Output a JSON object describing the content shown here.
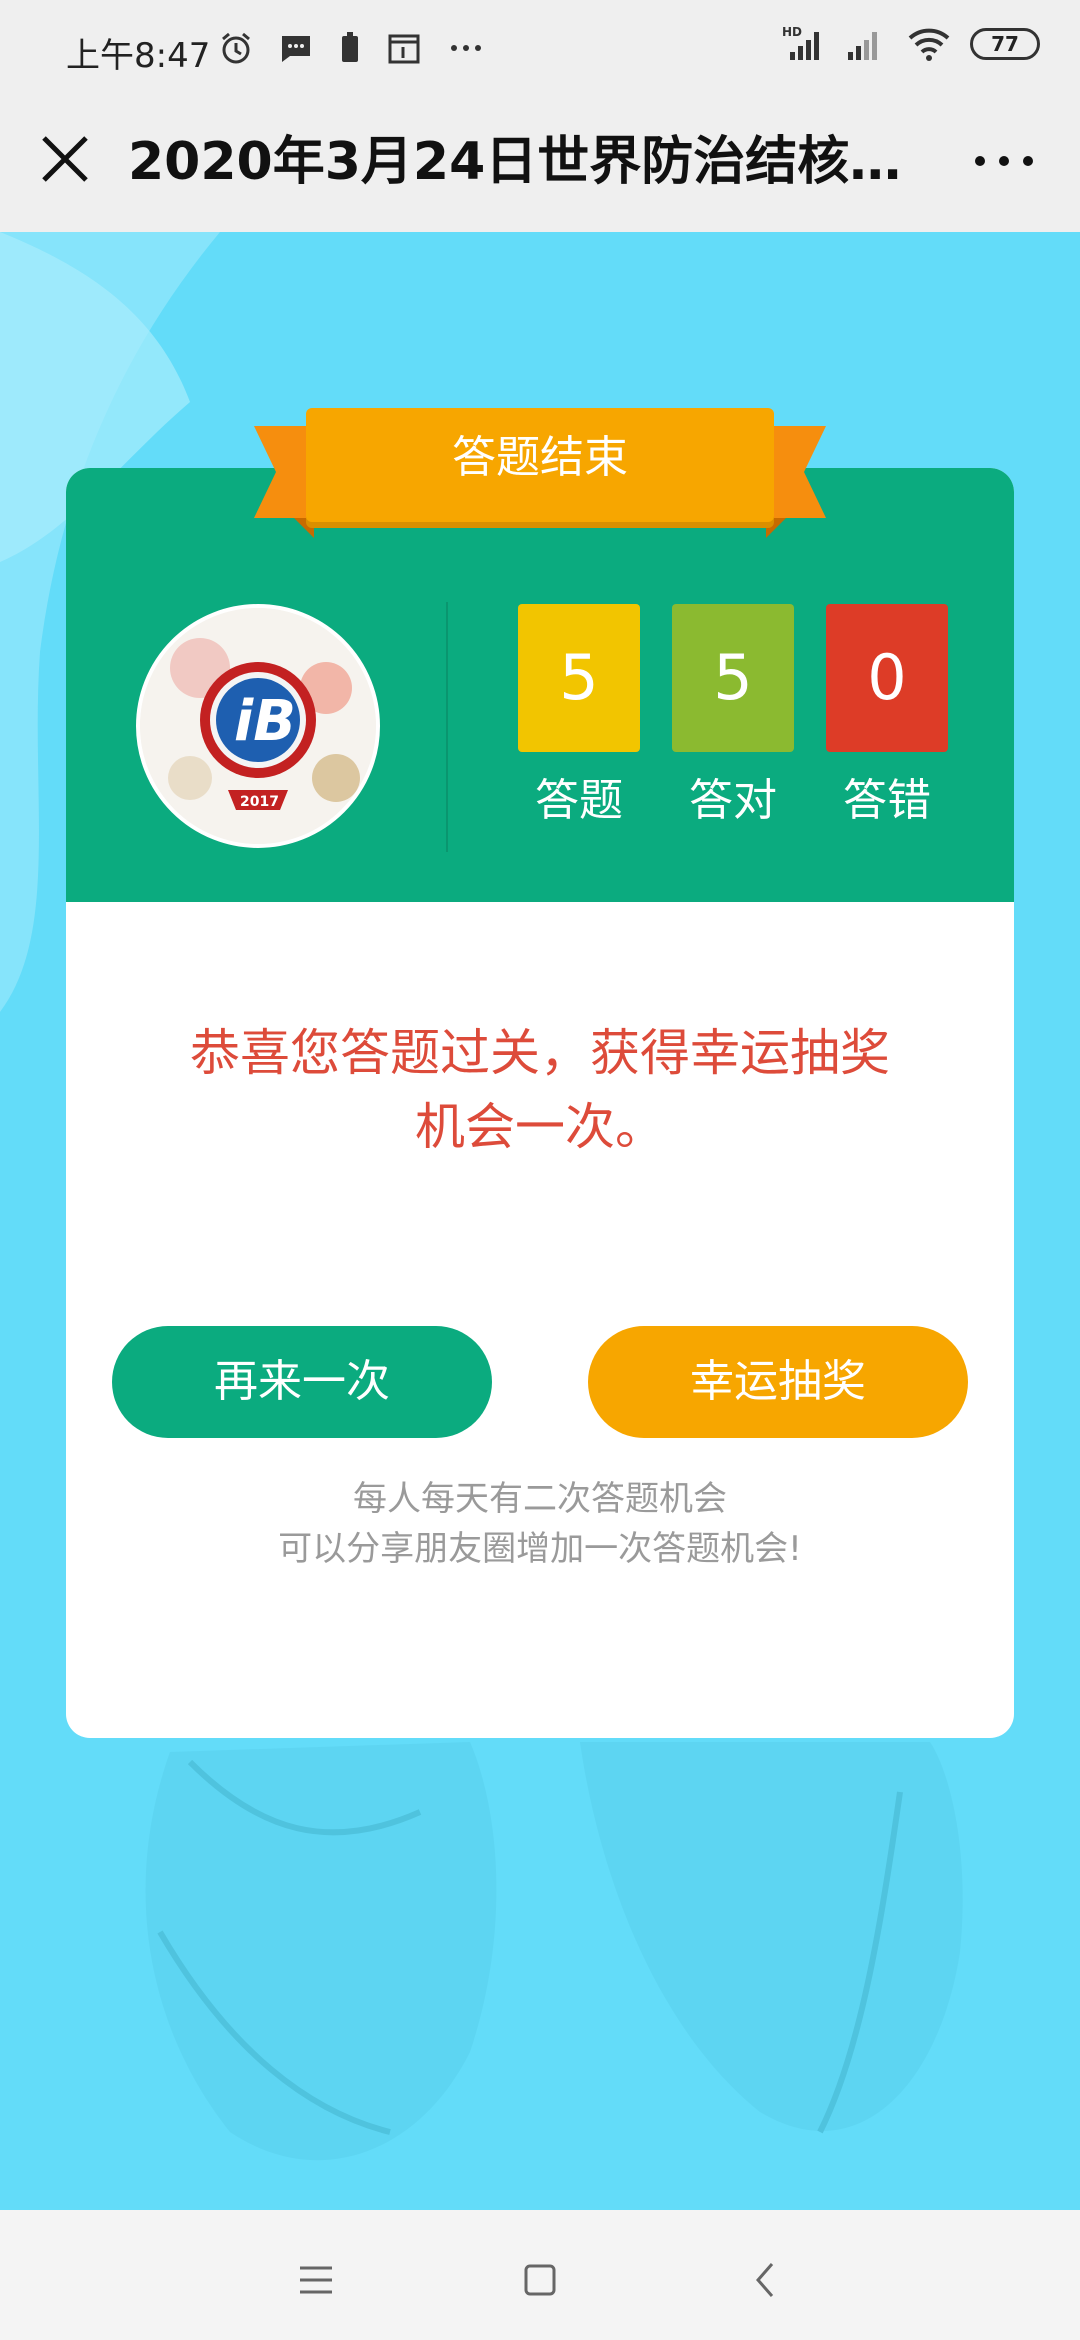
{
  "status_bar": {
    "time": "上午8:47",
    "battery": "77",
    "icons": [
      "alarm-icon",
      "message-icon",
      "battery-saver-icon",
      "calendar-icon",
      "more-dots-icon",
      "hd-signal-icon",
      "signal-icon",
      "wifi-icon"
    ]
  },
  "title_bar": {
    "title": "2020年3月24日世界防治结核…",
    "close_icon": "close-icon",
    "more_icon": "more-icon"
  },
  "result_card": {
    "ribbon_title": "答题结束",
    "stats": [
      {
        "value": "5",
        "label": "答题",
        "color": "#f2c500"
      },
      {
        "value": "5",
        "label": "答对",
        "color": "#8bba30"
      },
      {
        "value": "0",
        "label": "答错",
        "color": "#dd3c27"
      }
    ],
    "message": "恭喜您答题过关，获得幸运抽奖机会一次。",
    "retry_button": "再来一次",
    "lottery_button": "幸运抽奖",
    "note_line1": "每人每天有二次答题机会",
    "note_line2": "可以分享朋友圈增加一次答题机会!"
  },
  "avatar": {
    "badge_text": "2017"
  },
  "colors": {
    "background": "#63dcf9",
    "green": "#0bab7f",
    "orange": "#f7a600",
    "message_red": "#dd4b3a"
  }
}
